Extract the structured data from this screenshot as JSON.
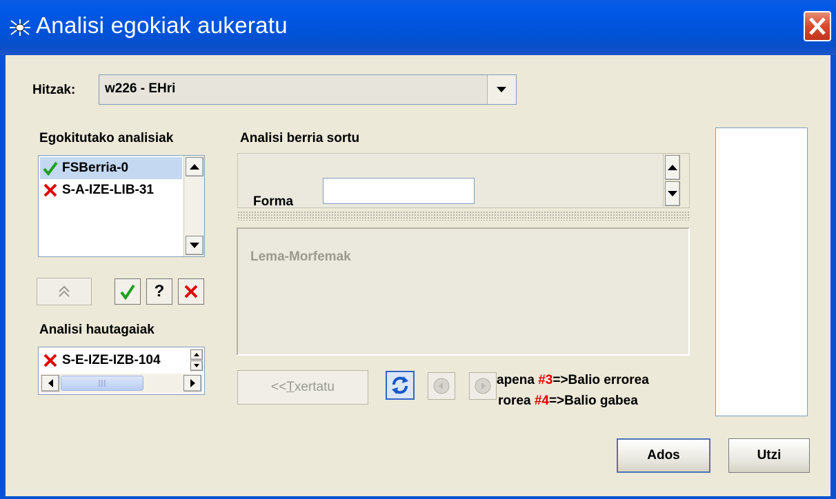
{
  "window": {
    "title": "Analisi egokiak aukeratu"
  },
  "colors": {
    "title_bar": "#0058e6",
    "close_button": "#d9492c",
    "check": "#1ea01e",
    "cross": "#e00000",
    "error_code": "#e00000"
  },
  "words": {
    "label": "Hitzak:",
    "selected": "w226 - EHri"
  },
  "assigned": {
    "title": "Egokitutako analisiak",
    "items": [
      {
        "label": "FSBerria-0",
        "status_icon": "check-icon",
        "selected": true
      },
      {
        "label": "S-A-IZE-LIB-31",
        "status_icon": "cross-icon",
        "selected": false
      }
    ]
  },
  "actions": {
    "move_up_icon": "double-up-icon",
    "accept_icon": "check-icon",
    "unknown_label": "?",
    "reject_icon": "cross-icon"
  },
  "candidates": {
    "title": "Analisi hautagaiak",
    "items": [
      {
        "label": "S-E-IZE-IZB-104",
        "status_icon": "cross-icon"
      }
    ]
  },
  "new_analysis": {
    "title": "Analisi berria sortu",
    "form_label": "Forma",
    "form_value": "",
    "lemma_title": "Lema-Morfemak",
    "insert_label": "<< Txertatu",
    "insert_mnemonic": "T",
    "insert_rest": "xertatu",
    "insert_prefix": "<< "
  },
  "legend": {
    "lines": [
      {
        "prefix": "apena ",
        "code": "#3",
        "text": "=>Balio errorea"
      },
      {
        "prefix": "rorea ",
        "code": "#4",
        "text": "=>Balio gabea"
      }
    ]
  },
  "buttons": {
    "ok": "Ados",
    "cancel": "Utzi"
  }
}
